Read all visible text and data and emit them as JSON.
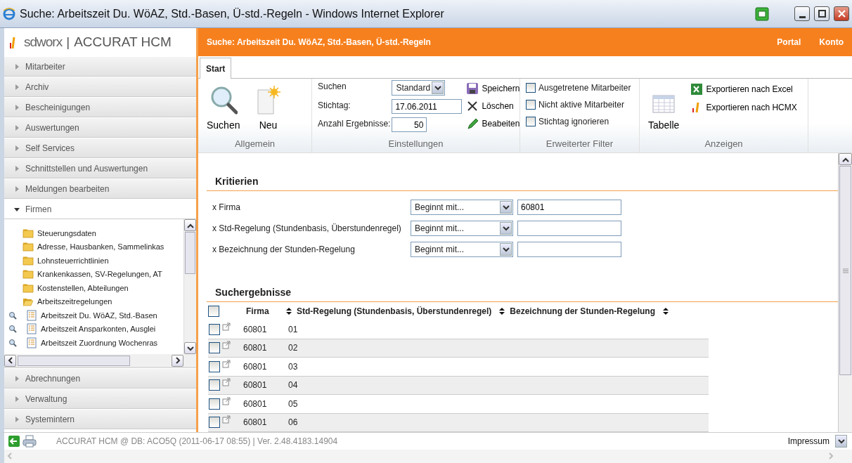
{
  "window": {
    "title": "Suche: Arbeitszeit Du. WöAZ, Std.-Basen, Ü-std.-Regeln - Windows Internet Explorer"
  },
  "sidebar": {
    "logo": {
      "brand": "sdworx",
      "separator": "|",
      "product": "ACCURAT HCM"
    },
    "sections": [
      {
        "label": "Mitarbeiter",
        "expanded": false
      },
      {
        "label": "Archiv",
        "expanded": false
      },
      {
        "label": "Bescheinigungen",
        "expanded": false
      },
      {
        "label": "Auswertungen",
        "expanded": false
      },
      {
        "label": "Self Services",
        "expanded": false
      },
      {
        "label": "Schnittstellen und Auswertungen",
        "expanded": false
      },
      {
        "label": "Meldungen bearbeiten",
        "expanded": false
      },
      {
        "label": "Firmen",
        "expanded": true,
        "children": [
          {
            "label": "Steuerungsdaten",
            "kind": "folder",
            "expanded": false
          },
          {
            "label": "Adresse, Hausbanken, Sammelinkas",
            "kind": "folder",
            "expanded": false
          },
          {
            "label": "Lohnsteuerrichtlinien",
            "kind": "folder",
            "expanded": false
          },
          {
            "label": "Krankenkassen, SV-Regelungen, AT",
            "kind": "folder",
            "expanded": false
          },
          {
            "label": "Kostenstellen, Abteilungen",
            "kind": "folder",
            "expanded": false
          },
          {
            "label": "Arbeitszeitregelungen",
            "kind": "folder",
            "expanded": true,
            "children": [
              {
                "label": "Arbeitszeit Du. WöAZ, Std.-Basen",
                "kind": "report"
              },
              {
                "label": "Arbeitszeit Ansparkonten, Ausglei",
                "kind": "report"
              },
              {
                "label": "Arbeitszeit Zuordnung Wochenras",
                "kind": "report"
              }
            ]
          }
        ]
      },
      {
        "label": "Abrechnungen",
        "expanded": false
      },
      {
        "label": "Verwaltung",
        "expanded": false
      },
      {
        "label": "Systemintern",
        "expanded": false
      }
    ]
  },
  "header": {
    "title": "Suche: Arbeitszeit Du. WöAZ, Std.-Basen, Ü-std.-Regeln",
    "links": [
      "Portal",
      "Konto"
    ]
  },
  "tabs": [
    {
      "label": "Start",
      "selected": true
    }
  ],
  "ribbon": {
    "allgemein": {
      "caption": "Allgemein",
      "buttons": [
        {
          "label": "Suchen",
          "kind": "search"
        },
        {
          "label": "Neu",
          "kind": "new"
        }
      ]
    },
    "einstellungen": {
      "caption": "Einstellungen",
      "fields": [
        {
          "label": "Suchen",
          "kind": "select",
          "value": "Standard"
        },
        {
          "label": "Stichtag:",
          "kind": "text",
          "value": "17.06.2011"
        },
        {
          "label": "Anzahl Ergebnisse:",
          "kind": "number",
          "value": "50"
        }
      ],
      "actions": [
        {
          "label": "Speichern",
          "kind": "save"
        },
        {
          "label": "Löschen",
          "kind": "delete"
        },
        {
          "label": "Beabeiten",
          "kind": "edit"
        }
      ]
    },
    "filter": {
      "caption": "Erweiterter Filter",
      "options": [
        {
          "label": "Ausgetretene Mitarbeiter",
          "checked": false
        },
        {
          "label": "Nicht aktive Mitarbeiter",
          "checked": false
        },
        {
          "label": "Stichtag ignorieren",
          "checked": false
        }
      ]
    },
    "anzeigen": {
      "caption": "Anzeigen",
      "view": "Tabelle",
      "exports": [
        {
          "label": "Exportieren nach Excel",
          "kind": "excel"
        },
        {
          "label": "Exportieren nach HCMX",
          "kind": "hcmx"
        }
      ]
    }
  },
  "criteria": {
    "title": "Kritierien",
    "rows": [
      {
        "label": "x Firma",
        "operator": "Beginnt mit...",
        "value": "60801"
      },
      {
        "label": "x Std-Regelung (Stundenbasis, Überstundenregel)",
        "operator": "Beginnt mit..."
      },
      {
        "label": "x Bezeichnung der Stunden-Regelung",
        "operator": "Beginnt mit..."
      }
    ]
  },
  "results": {
    "title": "Suchergebnisse",
    "select_all": {
      "checked": false
    },
    "columns": [
      "Firma",
      "Std-Regelung (Stundenbasis, Überstundenregel)",
      "Bezeichnung der Stunden-Regelung"
    ],
    "rows": [
      {
        "checked": false,
        "firma": "60801",
        "regelung": "01"
      },
      {
        "checked": false,
        "firma": "60801",
        "regelung": "02"
      },
      {
        "checked": false,
        "firma": "60801",
        "regelung": "03"
      },
      {
        "checked": false,
        "firma": "60801",
        "regelung": "04"
      },
      {
        "checked": false,
        "firma": "60801",
        "regelung": "05"
      },
      {
        "checked": false,
        "firma": "60801",
        "regelung": "06"
      }
    ]
  },
  "status_bar": {
    "text": "ACCURAT HCM @ DB: ACO5Q (2011-06-17 08:55) | Ver. 2.48.4183.14904",
    "link": "Impressum"
  }
}
